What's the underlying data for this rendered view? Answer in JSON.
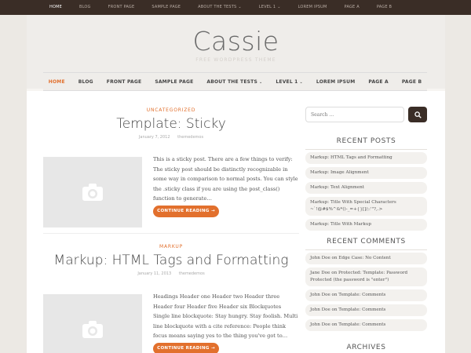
{
  "top_nav": {
    "items": [
      {
        "label": "HOME",
        "active": true
      },
      {
        "label": "BLOG"
      },
      {
        "label": "FRONT PAGE"
      },
      {
        "label": "SAMPLE PAGE"
      },
      {
        "label": "ABOUT THE TESTS",
        "caret": "⌄"
      },
      {
        "label": "LEVEL 1",
        "caret": "⌄"
      },
      {
        "label": "LOREM IPSUM"
      },
      {
        "label": "PAGE A"
      },
      {
        "label": "PAGE B"
      }
    ]
  },
  "site": {
    "title": "Cassie",
    "description": "FREE WORDPRESS THEME"
  },
  "main_nav": {
    "items": [
      {
        "label": "HOME",
        "active": true
      },
      {
        "label": "BLOG"
      },
      {
        "label": "FRONT PAGE"
      },
      {
        "label": "SAMPLE PAGE"
      },
      {
        "label": "ABOUT THE TESTS",
        "caret": "⌄"
      },
      {
        "label": "LEVEL 1",
        "caret": "⌄"
      },
      {
        "label": "LOREM IPSUM"
      },
      {
        "label": "PAGE A"
      },
      {
        "label": "PAGE B"
      }
    ]
  },
  "posts": [
    {
      "category": "UNCATEGORIZED",
      "title": "Template: Sticky",
      "date": "January 7, 2012",
      "author": "themedemos",
      "excerpt": "This is a sticky post. There are a few things to verify: The sticky post should be distinctly recognizable in some way in comparison to normal posts. You can style the .sticky class if you are using the post_class() function to generate…",
      "button": "CONTINUE READING →"
    },
    {
      "category": "MARKUP",
      "title": "Markup: HTML Tags and Formatting",
      "date": "January 11, 2013",
      "author": "themedemos",
      "excerpt": "Headings Header one Header two Header three Header four Header five Header six Blockquotes Single line blockquote: Stay hungry. Stay foolish. Multi line blockquote with a cite reference: People think focus means saying yes to the thing you've got to…",
      "button": "CONTINUE READING →"
    }
  ],
  "sidebar": {
    "search_placeholder": "Search …",
    "recent_posts_title": "RECENT POSTS",
    "recent_posts": [
      "Markup: HTML Tags and Formatting",
      "Markup: Image Alignment",
      "Markup: Text Alignment",
      "Markup: Title With Special Characters ~`!@#$%^&*()-_=+{}[]/;:'\"?,.>",
      "Markup: Title With Markup"
    ],
    "recent_comments_title": "RECENT COMMENTS",
    "recent_comments": [
      "John Doe on Edge Case: No Content",
      "Jane Doe on Protected: Template: Password Protected (the password is \"enter\")",
      "John Doe on Template: Comments",
      "John Doe on Template: Comments",
      "John Doe on Template: Comments"
    ],
    "archives_title": "ARCHIVES"
  },
  "colors": {
    "accent": "#e2702d",
    "topbar": "#3a2d26"
  }
}
